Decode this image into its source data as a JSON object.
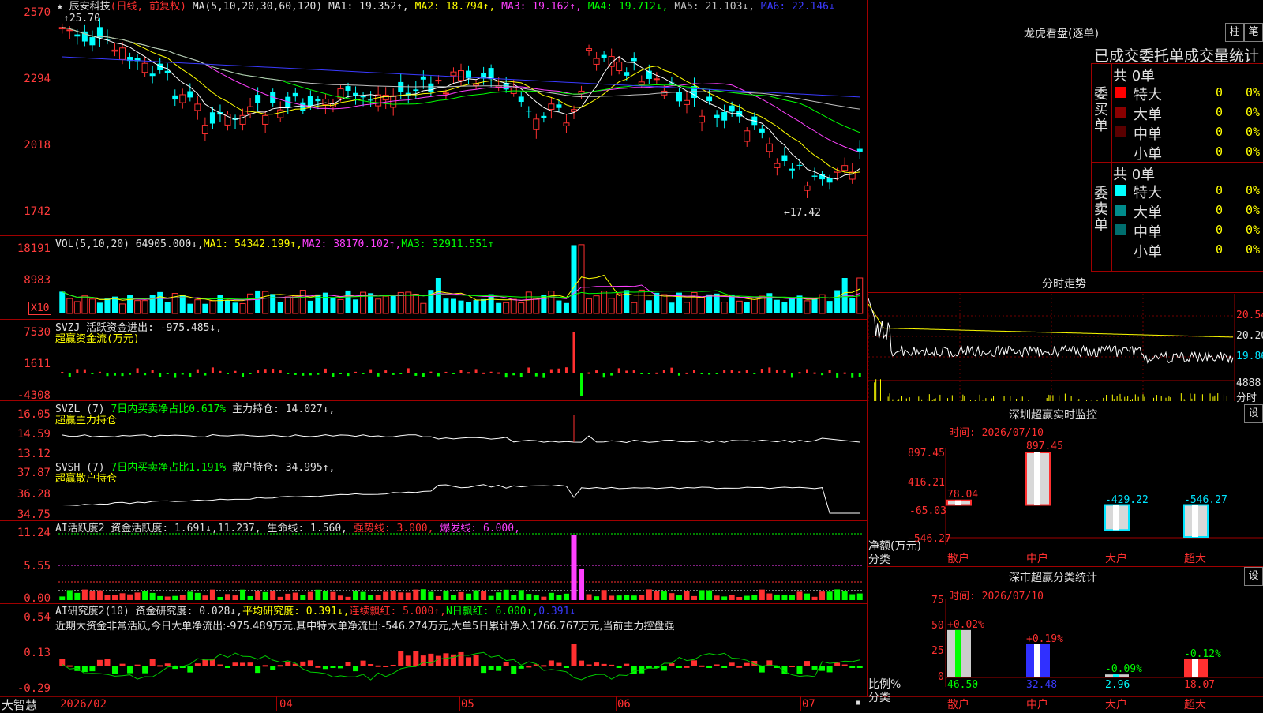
{
  "main": {
    "stock_name": "辰安科技",
    "period": "(日线, 前复权)",
    "ma_label": "MA(5,10,20,30,60,120)",
    "ma_items": [
      {
        "label": "MA1:",
        "value": "19.352↑,",
        "color": "#e0e0e0"
      },
      {
        "label": "MA2:",
        "value": "18.794↑,",
        "color": "#ffff00"
      },
      {
        "label": "MA3:",
        "value": "19.162↑,",
        "color": "#ff40ff"
      },
      {
        "label": "MA4:",
        "value": "19.712↓,",
        "color": "#00ff00"
      },
      {
        "label": "MA5:",
        "value": "21.103↓,",
        "color": "#c0c0c0"
      },
      {
        "label": "MA6:",
        "value": "22.146↓",
        "color": "#3a3aff"
      }
    ],
    "y_ticks": [
      "2570",
      "2294",
      "2018",
      "1742"
    ],
    "high_label": "25.70",
    "low_label": "17.42"
  },
  "vol": {
    "label": "VOL(5,10,20)",
    "value": "64905.000↓,",
    "ma1": "MA1: 54342.199↑,",
    "ma2": "MA2: 38170.102↑,",
    "ma3": "MA3: 32911.551↑",
    "y_ticks": [
      "18191",
      "8983"
    ],
    "unit": "X10"
  },
  "svzj": {
    "line1": "SVZJ  活跃资金进出: -975.485↓,",
    "line2": "超赢资金流(万元)",
    "y_ticks": [
      "7530",
      "1611",
      "-4308"
    ]
  },
  "svzl": {
    "name": "SVZL (7)",
    "pct": "7日内买卖净占比0.617%",
    "hold": "主力持仓: 14.027↓,",
    "line2": "超赢主力持仓",
    "y_ticks": [
      "16.05",
      "14.59",
      "13.12"
    ]
  },
  "svsh": {
    "name": "SVSH (7)",
    "pct": "7日内买卖净占比1.191%",
    "hold": "散户持仓: 34.995↑,",
    "line2": "超赢散户持仓",
    "y_ticks": [
      "37.87",
      "36.28",
      "34.75"
    ]
  },
  "ai_active": {
    "name": "AI活跃度2",
    "a": "资金活跃度: 1.691↓,",
    "b": "11.237,",
    "c": "生命线: 1.560,",
    "d": "强势线: 3.000,",
    "e": "爆发线: 6.000,",
    "y_ticks": [
      "11.24",
      "5.55",
      "0.00"
    ]
  },
  "ai_research": {
    "name": "AI研究度2(10)",
    "a": "资金研究度: 0.028↓,",
    "b": "平均研究度: 0.391↓,",
    "c": "连续飘红: 5.000↑,",
    "d": "N日飘红: 6.000↑,",
    "e": "0.391↓",
    "summary": "近期大资金非常活跃,今日大单净流出:-975.489万元,其中特大单净流出:-546.274万元,大单5日累计净入1766.767万元,当前主力控盘强",
    "y_ticks": [
      "0.54",
      "0.13",
      "-0.29"
    ]
  },
  "bottom": {
    "brand": "大智慧",
    "dates": [
      "2026/02",
      "04",
      "05",
      "06",
      "07"
    ]
  },
  "dragon": {
    "title": "龙虎看盘(逐单)",
    "btn1": "柱",
    "btn2": "笔",
    "header": "已成交委托单成交量统计",
    "buy_label": "委买单",
    "sell_label": "委卖单",
    "buy_total": "共 0单",
    "sell_total": "共 0单",
    "buy_rows": [
      {
        "name": "特大",
        "qty": "0",
        "pct": "0%",
        "color": "#ff0000"
      },
      {
        "name": "大单",
        "qty": "0",
        "pct": "0%",
        "color": "#8b0000"
      },
      {
        "name": "中单",
        "qty": "0",
        "pct": "0%",
        "color": "#5a0000"
      },
      {
        "name": "小单",
        "qty": "0",
        "pct": "0%",
        "color": ""
      }
    ],
    "sell_rows": [
      {
        "name": "特大",
        "qty": "0",
        "pct": "0%",
        "color": "#00ffff"
      },
      {
        "name": "大单",
        "qty": "0",
        "pct": "0%",
        "color": "#008b8b"
      },
      {
        "name": "中单",
        "qty": "0",
        "pct": "0%",
        "color": "#006e6e"
      },
      {
        "name": "小单",
        "qty": "0",
        "pct": "0%",
        "color": ""
      }
    ]
  },
  "intraday": {
    "title": "分时走势",
    "y_ticks": [
      "20.54",
      "20.20",
      "19.86"
    ],
    "vol_tick": "4888",
    "vol_label": "分时"
  },
  "monitor": {
    "title": "深圳超赢实时监控",
    "btn": "设",
    "time": "时间: 2026/07/10",
    "y_ticks": [
      "897.45",
      "416.21",
      "-65.03",
      "-546.27"
    ],
    "y_label": "净额(万元)",
    "x_label": "分类",
    "categories": [
      "散户",
      "中户",
      "大户",
      "超大"
    ],
    "values": [
      78.04,
      897.45,
      -429.22,
      -546.27
    ],
    "value_labels": [
      "78.04",
      "897.45",
      "-429.22",
      "-546.27"
    ]
  },
  "classify": {
    "title": "深市超赢分类统计",
    "btn": "设",
    "time": "时间: 2026/07/10",
    "y_ticks": [
      "75",
      "50",
      "25",
      "0"
    ],
    "y_label": "比例%",
    "x_label": "分类",
    "categories": [
      "散户",
      "中户",
      "大户",
      "超大"
    ],
    "values": [
      46.5,
      32.48,
      2.96,
      18.07
    ],
    "value_labels": [
      "46.50",
      "32.48",
      "2.96",
      "18.07"
    ],
    "changes": [
      "+0.02%",
      "+0.19%",
      "-0.09%",
      "-0.12%"
    ]
  }
}
